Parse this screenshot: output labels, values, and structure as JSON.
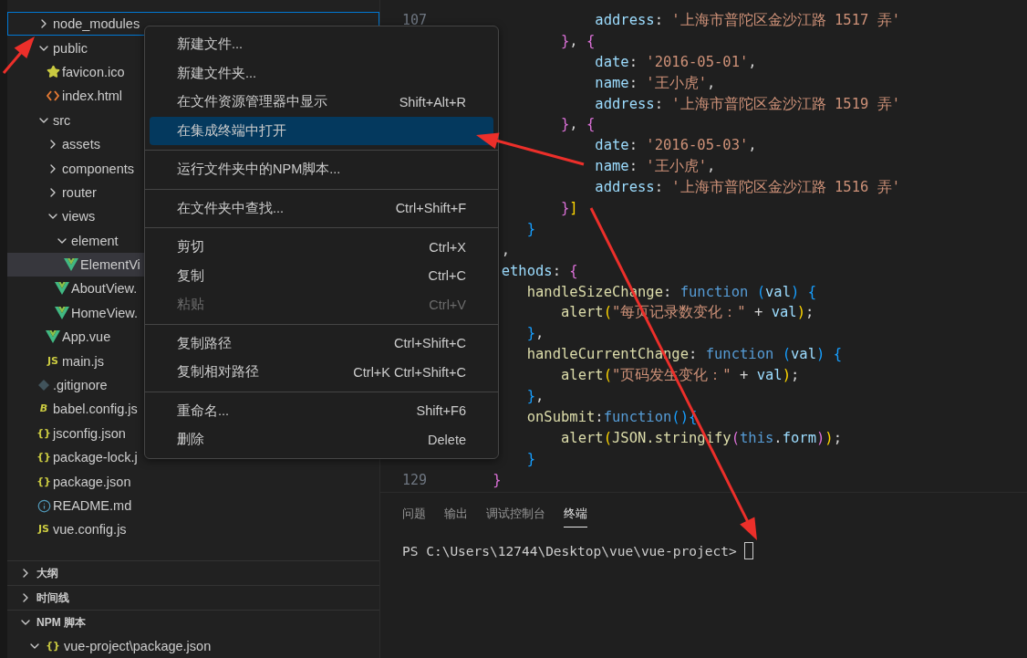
{
  "explorer": {
    "tree": [
      {
        "label": "node_modules",
        "kind": "folder",
        "expanded": false,
        "selected": false,
        "focused": true
      },
      {
        "label": "public",
        "kind": "folder",
        "expanded": true,
        "selected": false,
        "focused": false,
        "children": [
          {
            "label": "favicon.ico",
            "kind": "star",
            "selected": false,
            "focused": false
          },
          {
            "label": "index.html",
            "kind": "html",
            "selected": false,
            "focused": false
          }
        ]
      },
      {
        "label": "src",
        "kind": "folder",
        "expanded": true,
        "selected": false,
        "focused": false,
        "children": [
          {
            "label": "assets",
            "kind": "folder",
            "expanded": false,
            "selected": false,
            "focused": false
          },
          {
            "label": "components",
            "kind": "folder",
            "expanded": false,
            "selected": false,
            "focused": false
          },
          {
            "label": "router",
            "kind": "folder",
            "expanded": false,
            "selected": false,
            "focused": false
          },
          {
            "label": "views",
            "kind": "folder",
            "expanded": true,
            "selected": false,
            "focused": false,
            "children": [
              {
                "label": "element",
                "kind": "folder",
                "expanded": true,
                "selected": false,
                "focused": false,
                "children": [
                  {
                    "label": "ElementVi",
                    "kind": "vue",
                    "selected": true,
                    "focused": false
                  }
                ]
              },
              {
                "label": "AboutView.",
                "kind": "vue",
                "selected": false,
                "focused": false
              },
              {
                "label": "HomeView.",
                "kind": "vue",
                "selected": false,
                "focused": false
              }
            ]
          },
          {
            "label": "App.vue",
            "kind": "vue",
            "selected": false,
            "focused": false
          },
          {
            "label": "main.js",
            "kind": "label",
            "type_label": "JS",
            "selected": false,
            "focused": false
          }
        ]
      },
      {
        "label": ".gitignore",
        "kind": "git",
        "selected": false,
        "focused": false
      },
      {
        "label": "babel.config.js",
        "kind": "label",
        "type_label": "B",
        "selected": false,
        "focused": false
      },
      {
        "label": "jsconfig.json",
        "kind": "label",
        "type_label": "{}",
        "selected": false,
        "focused": false
      },
      {
        "label": "package-lock.j",
        "kind": "label",
        "type_label": "{}",
        "selected": false,
        "focused": false
      },
      {
        "label": "package.json",
        "kind": "label",
        "type_label": "{}",
        "selected": false,
        "focused": false
      },
      {
        "label": "README.md",
        "kind": "info",
        "selected": false,
        "focused": false
      },
      {
        "label": "vue.config.js",
        "kind": "label",
        "type_label": "JS",
        "selected": false,
        "focused": false
      }
    ],
    "sections": [
      {
        "title": "大纲",
        "expanded": false
      },
      {
        "title": "时间线",
        "expanded": false
      },
      {
        "title": "NPM 脚本",
        "expanded": true,
        "children": [
          {
            "label": "vue-project\\package.json",
            "type_label": "{}",
            "expanded": true
          }
        ]
      }
    ]
  },
  "editor": {
    "lines": [
      {
        "number": "107",
        "tokens": [
          {
            "kind": "key",
            "text": "                address"
          },
          {
            "kind": "punc",
            "text": ": "
          },
          {
            "kind": "str",
            "text": "'上海市普陀区金沙江路 1517 弄'"
          }
        ]
      },
      {
        "tokens": [
          {
            "kind": "b2",
            "text": "            }"
          },
          {
            "kind": "punc",
            "text": ", "
          },
          {
            "kind": "b2",
            "text": "{"
          }
        ]
      },
      {
        "tokens": [
          {
            "kind": "key",
            "text": "                date"
          },
          {
            "kind": "punc",
            "text": ": "
          },
          {
            "kind": "str",
            "text": "'2016-05-01'"
          },
          {
            "kind": "punc",
            "text": ","
          }
        ]
      },
      {
        "tokens": [
          {
            "kind": "key",
            "text": "                name"
          },
          {
            "kind": "punc",
            "text": ": "
          },
          {
            "kind": "str",
            "text": "'王小虎'"
          },
          {
            "kind": "punc",
            "text": ","
          }
        ]
      },
      {
        "tokens": [
          {
            "kind": "key",
            "text": "                address"
          },
          {
            "kind": "punc",
            "text": ": "
          },
          {
            "kind": "str",
            "text": "'上海市普陀区金沙江路 1519 弄'"
          }
        ]
      },
      {
        "tokens": [
          {
            "kind": "b2",
            "text": "            }"
          },
          {
            "kind": "punc",
            "text": ", "
          },
          {
            "kind": "b2",
            "text": "{"
          }
        ]
      },
      {
        "tokens": [
          {
            "kind": "key",
            "text": "                date"
          },
          {
            "kind": "punc",
            "text": ": "
          },
          {
            "kind": "str",
            "text": "'2016-05-03'"
          },
          {
            "kind": "punc",
            "text": ","
          }
        ]
      },
      {
        "tokens": [
          {
            "kind": "key",
            "text": "                name"
          },
          {
            "kind": "punc",
            "text": ": "
          },
          {
            "kind": "str",
            "text": "'王小虎'"
          },
          {
            "kind": "punc",
            "text": ","
          }
        ]
      },
      {
        "tokens": [
          {
            "kind": "key",
            "text": "                address"
          },
          {
            "kind": "punc",
            "text": ": "
          },
          {
            "kind": "str",
            "text": "'上海市普陀区金沙江路 1516 弄'"
          }
        ]
      },
      {
        "tokens": [
          {
            "kind": "b2",
            "text": "            }"
          },
          {
            "kind": "b1",
            "text": "]"
          }
        ]
      },
      {
        "tokens": [
          {
            "kind": "b3",
            "text": "        }"
          }
        ]
      },
      {
        "tokens": [
          {
            "kind": "punc",
            "text": "     ,"
          }
        ]
      },
      {
        "tokens": [
          {
            "kind": "key",
            "text": "     ethods"
          },
          {
            "kind": "punc",
            "text": ": "
          },
          {
            "kind": "b2",
            "text": "{"
          }
        ]
      },
      {
        "tokens": [
          {
            "kind": "fn",
            "text": "        handleSizeChange"
          },
          {
            "kind": "punc",
            "text": ": "
          },
          {
            "kind": "kw",
            "text": "function "
          },
          {
            "kind": "b3",
            "text": "("
          },
          {
            "kind": "key",
            "text": "val"
          },
          {
            "kind": "b3",
            "text": ") {"
          }
        ]
      },
      {
        "tokens": [
          {
            "kind": "fn",
            "text": "            alert"
          },
          {
            "kind": "b1",
            "text": "("
          },
          {
            "kind": "str",
            "text": "\"每页记录数变化：\""
          },
          {
            "kind": "punc",
            "text": " + "
          },
          {
            "kind": "key",
            "text": "val"
          },
          {
            "kind": "b1",
            "text": ")"
          },
          {
            "kind": "punc",
            "text": ";"
          }
        ]
      },
      {
        "tokens": [
          {
            "kind": "b3",
            "text": "        }"
          },
          {
            "kind": "punc",
            "text": ","
          }
        ]
      },
      {
        "tokens": [
          {
            "kind": "fn",
            "text": "        handleCurrentChange"
          },
          {
            "kind": "punc",
            "text": ": "
          },
          {
            "kind": "kw",
            "text": "function "
          },
          {
            "kind": "b3",
            "text": "("
          },
          {
            "kind": "key",
            "text": "val"
          },
          {
            "kind": "b3",
            "text": ") {"
          }
        ]
      },
      {
        "tokens": [
          {
            "kind": "fn",
            "text": "            alert"
          },
          {
            "kind": "b1",
            "text": "("
          },
          {
            "kind": "str",
            "text": "\"页码发生变化：\""
          },
          {
            "kind": "punc",
            "text": " + "
          },
          {
            "kind": "key",
            "text": "val"
          },
          {
            "kind": "b1",
            "text": ")"
          },
          {
            "kind": "punc",
            "text": ";"
          }
        ]
      },
      {
        "tokens": [
          {
            "kind": "b3",
            "text": "        }"
          },
          {
            "kind": "punc",
            "text": ","
          }
        ]
      },
      {
        "tokens": [
          {
            "kind": "fn",
            "text": "        onSubmit"
          },
          {
            "kind": "punc",
            "text": ":"
          },
          {
            "kind": "kw",
            "text": "function"
          },
          {
            "kind": "b3",
            "text": "(){"
          }
        ]
      },
      {
        "tokens": [
          {
            "kind": "fn",
            "text": "            alert"
          },
          {
            "kind": "b1",
            "text": "("
          },
          {
            "kind": "fn",
            "text": "JSON.stringify"
          },
          {
            "kind": "b2",
            "text": "("
          },
          {
            "kind": "kw",
            "text": "this"
          },
          {
            "kind": "punc",
            "text": "."
          },
          {
            "kind": "key",
            "text": "form"
          },
          {
            "kind": "b2",
            "text": ")"
          },
          {
            "kind": "b1",
            "text": ")"
          },
          {
            "kind": "punc",
            "text": ";"
          }
        ]
      },
      {
        "tokens": [
          {
            "kind": "b3",
            "text": "        }"
          }
        ]
      },
      {
        "number": "129",
        "tokens": [
          {
            "kind": "b2",
            "text": "    }"
          }
        ]
      }
    ]
  },
  "panel": {
    "tabs": [
      {
        "label": "问题",
        "selected": false
      },
      {
        "label": "输出",
        "selected": false
      },
      {
        "label": "调试控制台",
        "selected": false
      },
      {
        "label": "终端",
        "selected": true
      }
    ],
    "terminal": {
      "prompt": "PS C:\\Users\\12744\\Desktop\\vue\\vue-project>"
    }
  },
  "context_menu": {
    "items": [
      {
        "kind": "item",
        "label": "新建文件...",
        "selected": false,
        "disabled": false
      },
      {
        "kind": "item",
        "label": "新建文件夹...",
        "selected": false,
        "disabled": false
      },
      {
        "kind": "item",
        "label": "在文件资源管理器中显示",
        "shortcut": "Shift+Alt+R",
        "selected": false,
        "disabled": false
      },
      {
        "kind": "item",
        "label": "在集成终端中打开",
        "selected": true,
        "disabled": false
      },
      {
        "kind": "separator"
      },
      {
        "kind": "item",
        "label": "运行文件夹中的NPM脚本...",
        "selected": false,
        "disabled": false
      },
      {
        "kind": "separator"
      },
      {
        "kind": "item",
        "label": "在文件夹中查找...",
        "shortcut": "Ctrl+Shift+F",
        "selected": false,
        "disabled": false
      },
      {
        "kind": "separator"
      },
      {
        "kind": "item",
        "label": "剪切",
        "shortcut": "Ctrl+X",
        "selected": false,
        "disabled": false
      },
      {
        "kind": "item",
        "label": "复制",
        "shortcut": "Ctrl+C",
        "selected": false,
        "disabled": false
      },
      {
        "kind": "item",
        "label": "粘贴",
        "shortcut": "Ctrl+V",
        "selected": false,
        "disabled": true
      },
      {
        "kind": "separator"
      },
      {
        "kind": "item",
        "label": "复制路径",
        "shortcut": "Ctrl+Shift+C",
        "selected": false,
        "disabled": false
      },
      {
        "kind": "item",
        "label": "复制相对路径",
        "shortcut": "Ctrl+K Ctrl+Shift+C",
        "selected": false,
        "disabled": false
      },
      {
        "kind": "separator"
      },
      {
        "kind": "item",
        "label": "重命名...",
        "shortcut": "Shift+F6",
        "selected": false,
        "disabled": false
      },
      {
        "kind": "item",
        "label": "删除",
        "shortcut": "Delete",
        "selected": false,
        "disabled": false
      }
    ]
  }
}
